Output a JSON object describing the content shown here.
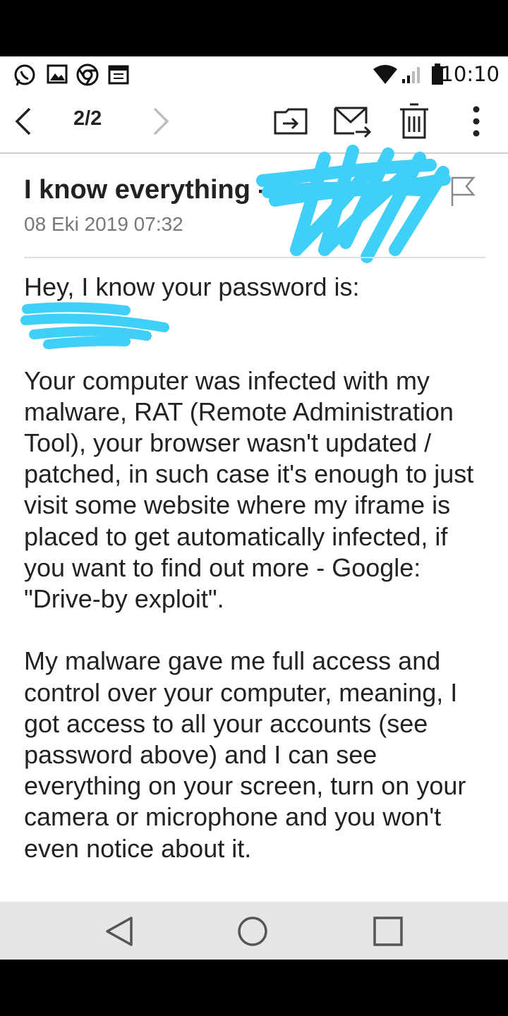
{
  "status_bar": {
    "time": "10:10",
    "left_icons": [
      "whatsapp-icon",
      "gallery-icon",
      "chrome-icon",
      "calendar-icon"
    ],
    "right_icons": [
      "wifi-icon",
      "signal-icon",
      "battery-icon"
    ]
  },
  "toolbar": {
    "pager": "2/2",
    "icons": [
      "back-chevron-icon",
      "next-chevron-icon",
      "move-to-folder-icon",
      "forward-mail-icon",
      "delete-icon",
      "more-vert-icon"
    ]
  },
  "email": {
    "subject": "I know everything -",
    "date": "08 Eki 2019 07:32",
    "body": {
      "p1": "Hey, I know your password is:",
      "p2": "Your computer was infected with my malware, RAT (Remote Administration Tool), your browser wasn't updated / patched, in such case it's enough to just visit some website where my iframe is placed to get automatically infected, if you want to find out more - Google: \"Drive-by exploit\".",
      "p3": "My malware gave me full access and control over your computer, meaning, I got access to all your accounts (see password above) and I can see everything on your screen, turn on your camera or microphone and you won't even notice about it."
    }
  },
  "redaction_color": "#3fcff7",
  "nav_bar": {
    "icons": [
      "back-triangle-icon",
      "home-circle-icon",
      "recents-square-icon"
    ]
  }
}
